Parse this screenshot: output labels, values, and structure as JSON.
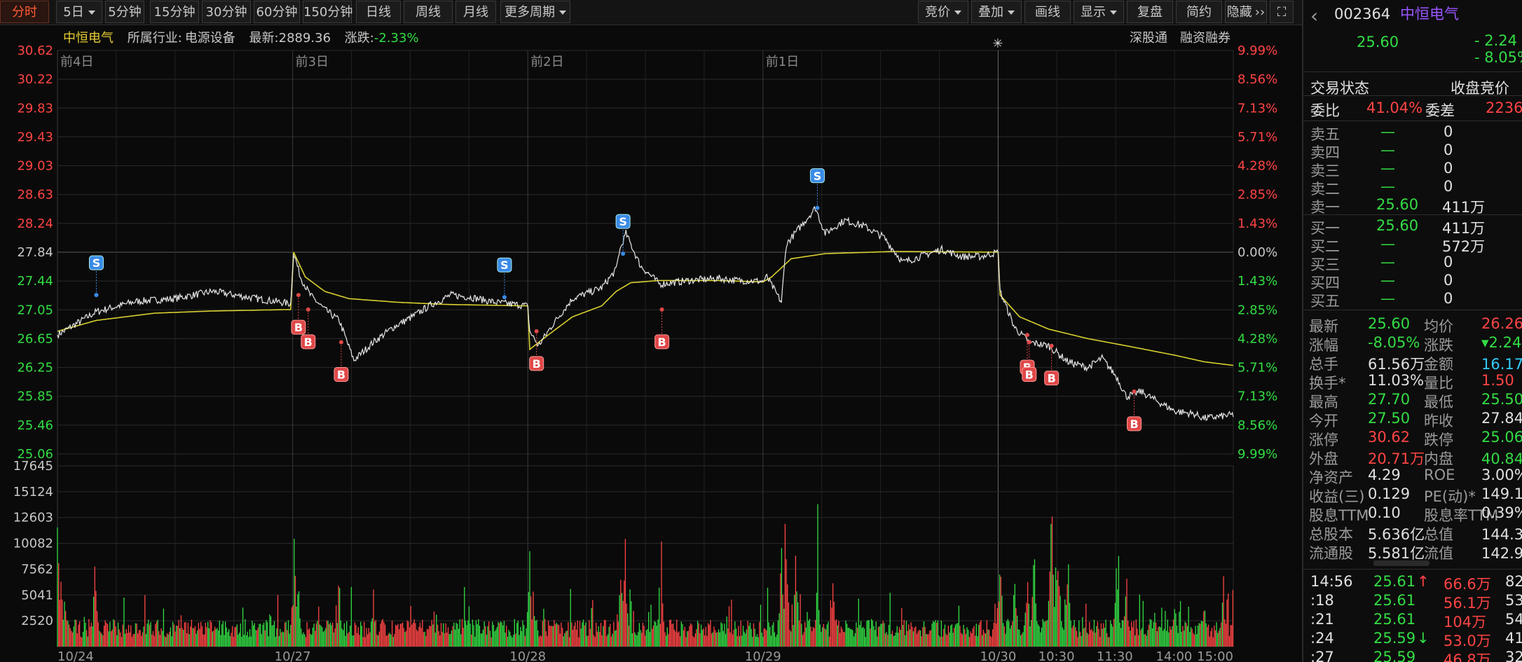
{
  "toolbar": {
    "tabs": [
      {
        "label": "分时",
        "active": true
      },
      {
        "label": "5日",
        "dropdown": true
      },
      {
        "label": "5分钟"
      },
      {
        "label": "15分钟"
      },
      {
        "label": "30分钟"
      },
      {
        "label": "60分钟"
      },
      {
        "label": "150分钟"
      },
      {
        "label": "日线"
      },
      {
        "label": "周线"
      },
      {
        "label": "月线"
      },
      {
        "label": "更多周期",
        "dropdown": true
      }
    ],
    "right_tabs": [
      {
        "label": "竞价",
        "dropdown": true
      },
      {
        "label": "叠加",
        "dropdown": true
      },
      {
        "label": "画线"
      },
      {
        "label": "显示",
        "dropdown": true
      },
      {
        "label": "复盘"
      },
      {
        "label": "简约"
      },
      {
        "label": "隐藏",
        "icon": "double-chevron-right-icon"
      }
    ],
    "fullscreen_icon": "fullscreen-icon"
  },
  "info": {
    "stock_name": "中恒电气",
    "industry_label": "所属行业:",
    "industry": "电源设备",
    "latest_label": "最新:",
    "latest": "2889.36",
    "change_label": "涨跌:",
    "change": "-2.33%",
    "links": [
      "深股通",
      "融资融券"
    ]
  },
  "chart_data": {
    "type": "line",
    "title": "",
    "day_labels": [
      "前4日",
      "前3日",
      "前2日",
      "前1日"
    ],
    "x_labels": [
      "10/24",
      "10/27",
      "10/28",
      "10/29",
      "10/30",
      "10:30",
      "11:30",
      "14:00",
      "15:00"
    ],
    "y_left_ticks": [
      "30.62",
      "30.22",
      "29.83",
      "29.43",
      "29.03",
      "28.63",
      "28.24",
      "27.84",
      "27.44",
      "27.05",
      "26.65",
      "26.25",
      "25.85",
      "25.46",
      "25.06"
    ],
    "y_right_ticks": [
      "9.99%",
      "8.56%",
      "7.13%",
      "5.71%",
      "4.28%",
      "2.85%",
      "1.43%",
      "0.00%",
      "1.43%",
      "2.85%",
      "4.28%",
      "5.71%",
      "7.13%",
      "8.56%",
      "9.99%"
    ],
    "prev_close": 27.84,
    "ylim": [
      25.06,
      30.62
    ],
    "price_series": {
      "name": "价格",
      "keypoints": [
        [
          0,
          26.7
        ],
        [
          40,
          27.02
        ],
        [
          80,
          27.16
        ],
        [
          120,
          27.2
        ],
        [
          160,
          27.3
        ],
        [
          200,
          27.21
        ],
        [
          240,
          27.13
        ],
        [
          243,
          27.84
        ],
        [
          250,
          27.5
        ],
        [
          260,
          27.25
        ],
        [
          275,
          27.05
        ],
        [
          290,
          26.9
        ],
        [
          305,
          26.35
        ],
        [
          325,
          26.6
        ],
        [
          345,
          26.8
        ],
        [
          365,
          26.95
        ],
        [
          385,
          27.12
        ],
        [
          405,
          27.25
        ],
        [
          425,
          27.22
        ],
        [
          450,
          27.15
        ],
        [
          484,
          27.1
        ],
        [
          486,
          26.75
        ],
        [
          495,
          26.55
        ],
        [
          510,
          26.85
        ],
        [
          530,
          27.2
        ],
        [
          560,
          27.35
        ],
        [
          575,
          27.6
        ],
        [
          578,
          27.84
        ],
        [
          585,
          28.1
        ],
        [
          600,
          27.65
        ],
        [
          620,
          27.4
        ],
        [
          650,
          27.45
        ],
        [
          680,
          27.48
        ],
        [
          700,
          27.45
        ],
        [
          726,
          27.44
        ],
        [
          730,
          27.5
        ],
        [
          745,
          27.15
        ],
        [
          750,
          27.95
        ],
        [
          765,
          28.2
        ],
        [
          780,
          28.45
        ],
        [
          790,
          28.1
        ],
        [
          810,
          28.28
        ],
        [
          830,
          28.2
        ],
        [
          850,
          28.05
        ],
        [
          870,
          27.7
        ],
        [
          890,
          27.79
        ],
        [
          910,
          27.88
        ],
        [
          930,
          27.78
        ],
        [
          950,
          27.78
        ],
        [
          968,
          27.84
        ],
        [
          970,
          27.3
        ],
        [
          985,
          26.8
        ],
        [
          1000,
          26.6
        ],
        [
          1020,
          26.55
        ],
        [
          1040,
          26.33
        ],
        [
          1060,
          26.25
        ],
        [
          1075,
          26.38
        ],
        [
          1090,
          26.12
        ],
        [
          1100,
          25.85
        ],
        [
          1115,
          25.92
        ],
        [
          1130,
          25.8
        ],
        [
          1150,
          25.65
        ],
        [
          1170,
          25.61
        ],
        [
          1180,
          25.55
        ],
        [
          1210,
          25.6
        ]
      ]
    },
    "avg_series": {
      "name": "均价",
      "keypoints": [
        [
          0,
          26.75
        ],
        [
          40,
          26.9
        ],
        [
          100,
          27.0
        ],
        [
          160,
          27.03
        ],
        [
          240,
          27.05
        ],
        [
          243,
          27.84
        ],
        [
          255,
          27.5
        ],
        [
          275,
          27.3
        ],
        [
          300,
          27.2
        ],
        [
          350,
          27.15
        ],
        [
          400,
          27.12
        ],
        [
          484,
          27.1
        ],
        [
          486,
          26.5
        ],
        [
          505,
          26.7
        ],
        [
          530,
          26.95
        ],
        [
          560,
          27.1
        ],
        [
          575,
          27.3
        ],
        [
          590,
          27.42
        ],
        [
          620,
          27.45
        ],
        [
          680,
          27.45
        ],
        [
          726,
          27.43
        ],
        [
          735,
          27.5
        ],
        [
          755,
          27.75
        ],
        [
          790,
          27.82
        ],
        [
          860,
          27.85
        ],
        [
          968,
          27.84
        ],
        [
          970,
          27.25
        ],
        [
          990,
          26.95
        ],
        [
          1020,
          26.78
        ],
        [
          1060,
          26.65
        ],
        [
          1100,
          26.55
        ],
        [
          1150,
          26.42
        ],
        [
          1180,
          26.33
        ],
        [
          1210,
          26.28
        ]
      ]
    },
    "signals": [
      {
        "type": "S",
        "t": 40,
        "price": 27.25
      },
      {
        "type": "B",
        "t": 248,
        "price": 27.25
      },
      {
        "type": "B",
        "t": 258,
        "price": 27.05
      },
      {
        "type": "B",
        "t": 292,
        "price": 26.6
      },
      {
        "type": "S",
        "t": 460,
        "price": 27.22
      },
      {
        "type": "B",
        "t": 493,
        "price": 26.75
      },
      {
        "type": "S",
        "t": 582,
        "price": 27.82
      },
      {
        "type": "B",
        "t": 622,
        "price": 27.05
      },
      {
        "type": "S",
        "t": 782,
        "price": 28.45
      },
      {
        "type": "B",
        "t": 998,
        "price": 26.7
      },
      {
        "type": "B",
        "t": 1000,
        "price": 26.6
      },
      {
        "type": "B",
        "t": 1023,
        "price": 26.55
      },
      {
        "type": "B",
        "t": 1108,
        "price": 25.92
      }
    ],
    "volume": {
      "y_ticks": [
        "17645",
        "15124",
        "12603",
        "10082",
        "7562",
        "5041",
        "2520"
      ],
      "ymax": 17645,
      "peaks": [
        [
          0,
          15500
        ],
        [
          4,
          8000
        ],
        [
          8,
          6500
        ],
        [
          40,
          8200
        ],
        [
          244,
          13700
        ],
        [
          248,
          9000
        ],
        [
          290,
          8600
        ],
        [
          325,
          7000
        ],
        [
          486,
          11000
        ],
        [
          490,
          6500
        ],
        [
          580,
          10500
        ],
        [
          584,
          13900
        ],
        [
          622,
          7000
        ],
        [
          745,
          12600
        ],
        [
          750,
          13800
        ],
        [
          760,
          11500
        ],
        [
          782,
          9000
        ],
        [
          798,
          7900
        ],
        [
          970,
          14000
        ],
        [
          985,
          11000
        ],
        [
          998,
          8800
        ],
        [
          1005,
          12800
        ],
        [
          1023,
          17600
        ],
        [
          1030,
          14000
        ],
        [
          1040,
          11000
        ],
        [
          1090,
          10500
        ],
        [
          1100,
          8200
        ],
        [
          1150,
          6500
        ],
        [
          1180,
          6000
        ],
        [
          1200,
          7500
        ],
        [
          1210,
          6800
        ]
      ]
    }
  },
  "quote": {
    "code": "002364",
    "name": "中恒电气",
    "price": "25.60",
    "change": "- 2.24",
    "change_pct": "- 8.05%",
    "status_label": "交易状态",
    "status_value": "收盘竞价",
    "weibi_label": "委比",
    "weibi_value": "41.04%",
    "weicha_label": "委差",
    "weicha_value": "2236",
    "asks": [
      {
        "label": "卖五",
        "price": "—",
        "vol": "0"
      },
      {
        "label": "卖四",
        "price": "—",
        "vol": "0"
      },
      {
        "label": "卖三",
        "price": "—",
        "vol": "0"
      },
      {
        "label": "卖二",
        "price": "—",
        "vol": "0"
      },
      {
        "label": "卖一",
        "price": "25.60",
        "vol": "411万"
      }
    ],
    "bids": [
      {
        "label": "买一",
        "price": "25.60",
        "vol": "411万"
      },
      {
        "label": "买二",
        "price": "—",
        "vol": "572万"
      },
      {
        "label": "买三",
        "price": "—",
        "vol": "0"
      },
      {
        "label": "买四",
        "price": "—",
        "vol": "0"
      },
      {
        "label": "买五",
        "price": "—",
        "vol": "0"
      }
    ],
    "stats": [
      {
        "l1": "最新",
        "v1": "25.60",
        "c1": "green",
        "l2": "均价",
        "v2": "26.26",
        "c2": "red"
      },
      {
        "l1": "涨幅",
        "v1": "-8.05%",
        "c1": "green",
        "l2": "涨跌",
        "v2": "▾2.24",
        "c2": "green"
      },
      {
        "l1": "总手",
        "v1": "61.56万",
        "c1": "wht",
        "l2": "金额",
        "v2": "16.17亿",
        "c2": "cyan"
      },
      {
        "l1": "换手*",
        "v1": "11.03%",
        "c1": "wht",
        "l2": "量比",
        "v2": "1.50",
        "c2": "red"
      },
      {
        "l1": "最高",
        "v1": "27.70",
        "c1": "green",
        "l2": "最低",
        "v2": "25.50",
        "c2": "green"
      },
      {
        "l1": "今开",
        "v1": "27.50",
        "c1": "green",
        "l2": "昨收",
        "v2": "27.84",
        "c2": "wht"
      },
      {
        "l1": "涨停",
        "v1": "30.62",
        "c1": "red",
        "l2": "跌停",
        "v2": "25.06",
        "c2": "green"
      },
      {
        "l1": "外盘",
        "v1": "20.71万",
        "c1": "red",
        "l2": "内盘",
        "v2": "40.84万",
        "c2": "green"
      },
      {
        "l1": "净资产",
        "v1": "4.29",
        "c1": "wht",
        "l2": "ROE",
        "v2": "3.00%",
        "c2": "wht"
      },
      {
        "l1": "收益(三)",
        "v1": "0.129",
        "c1": "wht",
        "l2": "PE(动)*",
        "v2": "149.10",
        "c2": "wht"
      },
      {
        "l1": "股息TTM",
        "v1": "0.10",
        "c1": "wht",
        "l2": "股息率TTM",
        "v2": "0.39%",
        "c2": "wht"
      },
      {
        "l1": "总股本",
        "v1": "5.636亿",
        "c1": "wht",
        "l2": "总值",
        "v2": "144.3亿",
        "c2": "wht"
      },
      {
        "l1": "流通股",
        "v1": "5.581亿",
        "c1": "wht",
        "l2": "流值",
        "v2": "142.9亿",
        "c2": "wht"
      }
    ],
    "ticks": [
      {
        "time": "14:56",
        "price": "25.61",
        "arrow": "↑",
        "arrow_color": "red",
        "vol": "66.6万",
        "n": "82"
      },
      {
        "time": ":18",
        "price": "25.61",
        "arrow": "",
        "arrow_color": "",
        "vol": "56.1万",
        "n": "53"
      },
      {
        "time": ":21",
        "price": "25.61",
        "arrow": "",
        "arrow_color": "",
        "vol": "104万",
        "n": "54"
      },
      {
        "time": ":24",
        "price": "25.59",
        "arrow": "↓",
        "arrow_color": "green",
        "vol": "53.0万",
        "n": "41"
      },
      {
        "time": ":27",
        "price": "25.59",
        "arrow": "",
        "arrow_color": "",
        "vol": "46.8万",
        "n": "32"
      }
    ]
  },
  "colors": {
    "up": "#ff4444",
    "down": "#33dd44",
    "price_line": "#e8e8e8",
    "avg_line": "#d8d030",
    "grid": "#2a2a2a"
  }
}
